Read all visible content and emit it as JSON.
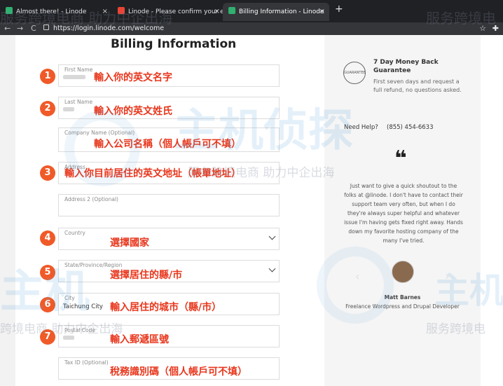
{
  "browser": {
    "tabs": [
      {
        "title": "Almost there! - Linode",
        "close": "×",
        "color": "#2fb170"
      },
      {
        "title": "Linode - Please confirm your e",
        "close": "×",
        "color": "#e94435"
      },
      {
        "title": "Billing Information - Linode",
        "close": "×",
        "color": "#2fb170"
      }
    ],
    "new_tab": "+",
    "nav": {
      "back": "←",
      "forward": "→",
      "reload": "C"
    },
    "url": "https://login.linode.com/welcome",
    "star": "☆",
    "extension": "✚"
  },
  "form": {
    "title": "Billing Information",
    "fields": [
      {
        "label": "First Name",
        "value": ""
      },
      {
        "label": "Last Name",
        "value": ""
      },
      {
        "label": "Company Name (Optional)",
        "value": ""
      },
      {
        "label": "Address",
        "value": ""
      },
      {
        "label": "Address 2 (Optional)",
        "value": ""
      },
      {
        "label": "Country",
        "value": ""
      },
      {
        "label": "State/Province/Region",
        "value": ""
      },
      {
        "label": "City",
        "value": "Taichung City"
      },
      {
        "label": "Postal Code",
        "value": ""
      },
      {
        "label": "Tax ID (Optional)",
        "value": ""
      }
    ]
  },
  "annotations": {
    "numbers": [
      "1",
      "2",
      "3",
      "4",
      "5",
      "6",
      "7"
    ],
    "notes": [
      "輸入你的英文名字",
      "輸入你的英文姓氏",
      "輸入公司名稱（個人帳戶可不填）",
      "輸入你目前居住的英文地址（帳單地址）",
      "選擇國家",
      "選擇居住的縣/市",
      "輸入居住的城市（縣/市）",
      "輸入郵遞區號",
      "稅務識別碼（個人帳戶可不填）"
    ],
    "color": "#e8371d",
    "badge_color": "#f05a28"
  },
  "sidebar": {
    "badge_text": "GUARANTEE",
    "money_back_title": "7 Day Money Back Guarantee",
    "money_back_text": "First seven days and request a full refund, no questions asked.",
    "help_label": "Need Help?",
    "phone": "(855) 454-6633",
    "quote_mark": "❝",
    "testimonial": "Just want to give a quick shoutout to the folks at @linode. I don't have to contact their support team very often, but when I do they're always super helpful and whatever issue I'm having gets fixed right away. Hands down my favorite hosting company of the many I've tried.",
    "author": "Matt Barnes",
    "author_role": "Freelance Wordpress and Drupal Developer",
    "prev": "‹",
    "next": "›"
  },
  "watermark": {
    "line1": "服务跨境电商 助力中企出海",
    "line2": "服务跨境电",
    "line3": "跨境电商 助力中企出海",
    "brand": "主机侦探",
    "brand_short": "主机",
    "brand_mid": "服务跨境电商 助力中企出海"
  }
}
